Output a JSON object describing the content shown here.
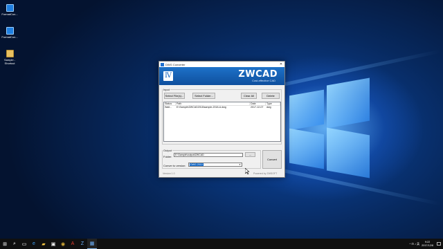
{
  "desktop": {
    "icons": [
      {
        "label": "FormatCon...",
        "icon": "app-icon"
      },
      {
        "label": "FormatCon...",
        "icon": "app-icon"
      },
      {
        "label": "Sample - Shortcut",
        "icon": "folder-shortcut-icon"
      }
    ]
  },
  "dialog": {
    "title": "DWG Converter",
    "close_glyph": "✕",
    "banner": {
      "logo_glyph": "Ⅳ",
      "brand": "ZWCAD",
      "tagline": "Cost-effective CAD"
    },
    "input": {
      "group_label": "Input",
      "buttons": {
        "select_files": "Select File(s)...",
        "select_folder": "Select Folder...",
        "clear_all": "Clear All",
        "delete": "Delete"
      },
      "columns": [
        "Status",
        "Path",
        "Date",
        "Type"
      ],
      "rows": [
        {
          "status": "Wait...",
          "path": "E:\\Sample\\ZWCAD2018\\sample-2018-A.dwg",
          "date": "2017-12-07",
          "type": "dwg"
        }
      ]
    },
    "output": {
      "group_label": "Output",
      "folder_label": "Folder:",
      "folder_value": "E:\\Sample\\output\\ZWCAD",
      "browse_label": "...",
      "convert_to_label": "Conver to version:",
      "version_selected": "DWG 2010",
      "convert_label": "Convert"
    },
    "footer": {
      "left": "Version 1.0",
      "right": "Powered by ZWSOFT"
    }
  },
  "taskbar": {
    "icons": [
      "windows-start-icon",
      "search-icon",
      "task-view-icon",
      "edge-icon",
      "file-explorer-icon",
      "store-icon",
      "chrome-icon",
      "acrobat-icon",
      "zwcad-icon",
      "dwg-converter-icon"
    ],
    "glyphs": [
      "⊞",
      "⌕",
      "▭",
      "e",
      "▰",
      "▣",
      "◉",
      "A",
      "Z",
      "▦"
    ],
    "tray": "^ ⊡ ♪ 英",
    "time": "9:22",
    "date": "2017/12/8"
  }
}
